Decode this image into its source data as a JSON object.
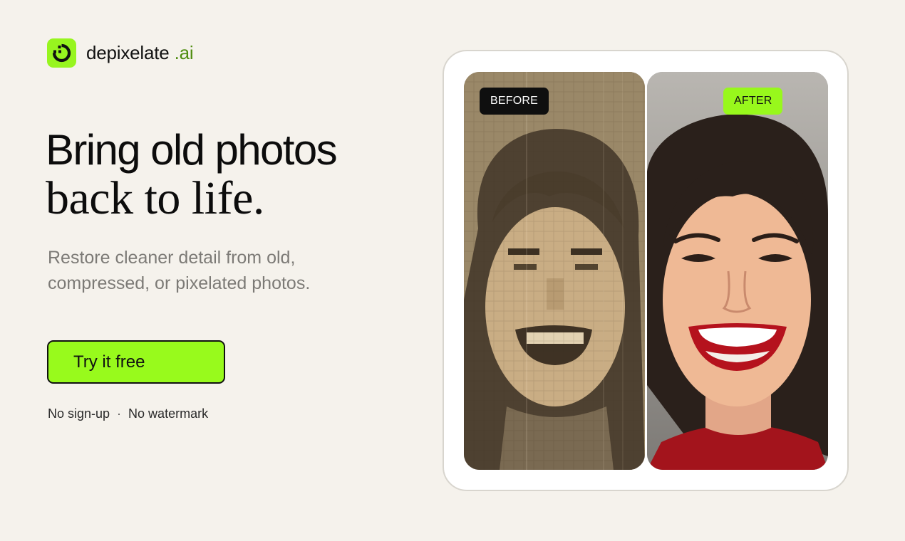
{
  "brand": {
    "name": "depixelate",
    "tld": ".ai",
    "icon": "depixelate-logo-icon",
    "accent_color": "#97f51f"
  },
  "hero": {
    "headline_line1": "Bring old photos",
    "headline_line2": "back to life.",
    "subtext": "Restore cleaner detail from old, compressed, or pixelated photos.",
    "cta_label": "Try it free",
    "perks": [
      "No sign-up",
      "No watermark"
    ],
    "perk_separator": "·"
  },
  "comparison": {
    "before_label": "BEFORE",
    "after_label": "AFTER",
    "before_image": "pixelated-sepia-portrait",
    "after_image": "restored-color-portrait"
  }
}
